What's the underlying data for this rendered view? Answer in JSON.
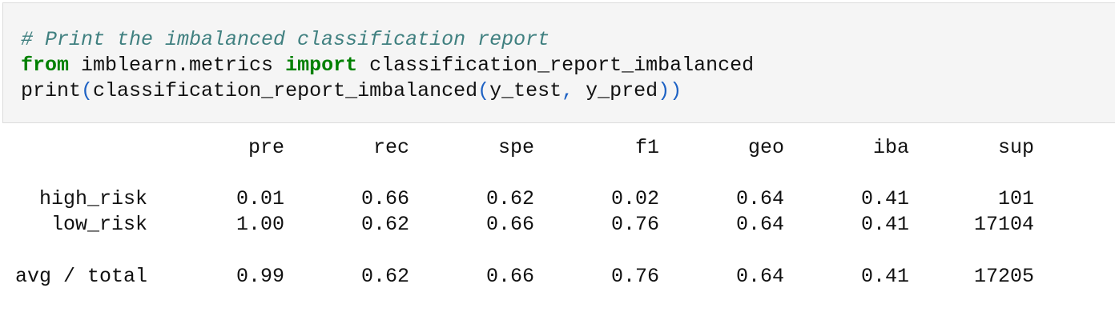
{
  "code": {
    "comment": "# Print the imbalanced classification report",
    "line2": {
      "kw_from": "from",
      "module": " imblearn.metrics ",
      "kw_import": "import",
      "name": " classification_report_imbalanced"
    },
    "line3": {
      "func": "print",
      "open1": "(",
      "inner": "classification_report_imbalanced",
      "open2": "(",
      "arg1": "y_test",
      "comma": ",",
      "arg2": " y_pred",
      "close": "))"
    }
  },
  "report": {
    "columns": [
      "pre",
      "rec",
      "spe",
      "f1",
      "geo",
      "iba",
      "sup"
    ],
    "rows": [
      {
        "label": "high_risk",
        "values": [
          "0.01",
          "0.66",
          "0.62",
          "0.02",
          "0.64",
          "0.41",
          "101"
        ]
      },
      {
        "label": "low_risk",
        "values": [
          "1.00",
          "0.62",
          "0.66",
          "0.76",
          "0.64",
          "0.41",
          "17104"
        ]
      },
      {
        "label": "avg / total",
        "values": [
          "0.99",
          "0.62",
          "0.66",
          "0.76",
          "0.64",
          "0.41",
          "17205"
        ]
      }
    ]
  }
}
